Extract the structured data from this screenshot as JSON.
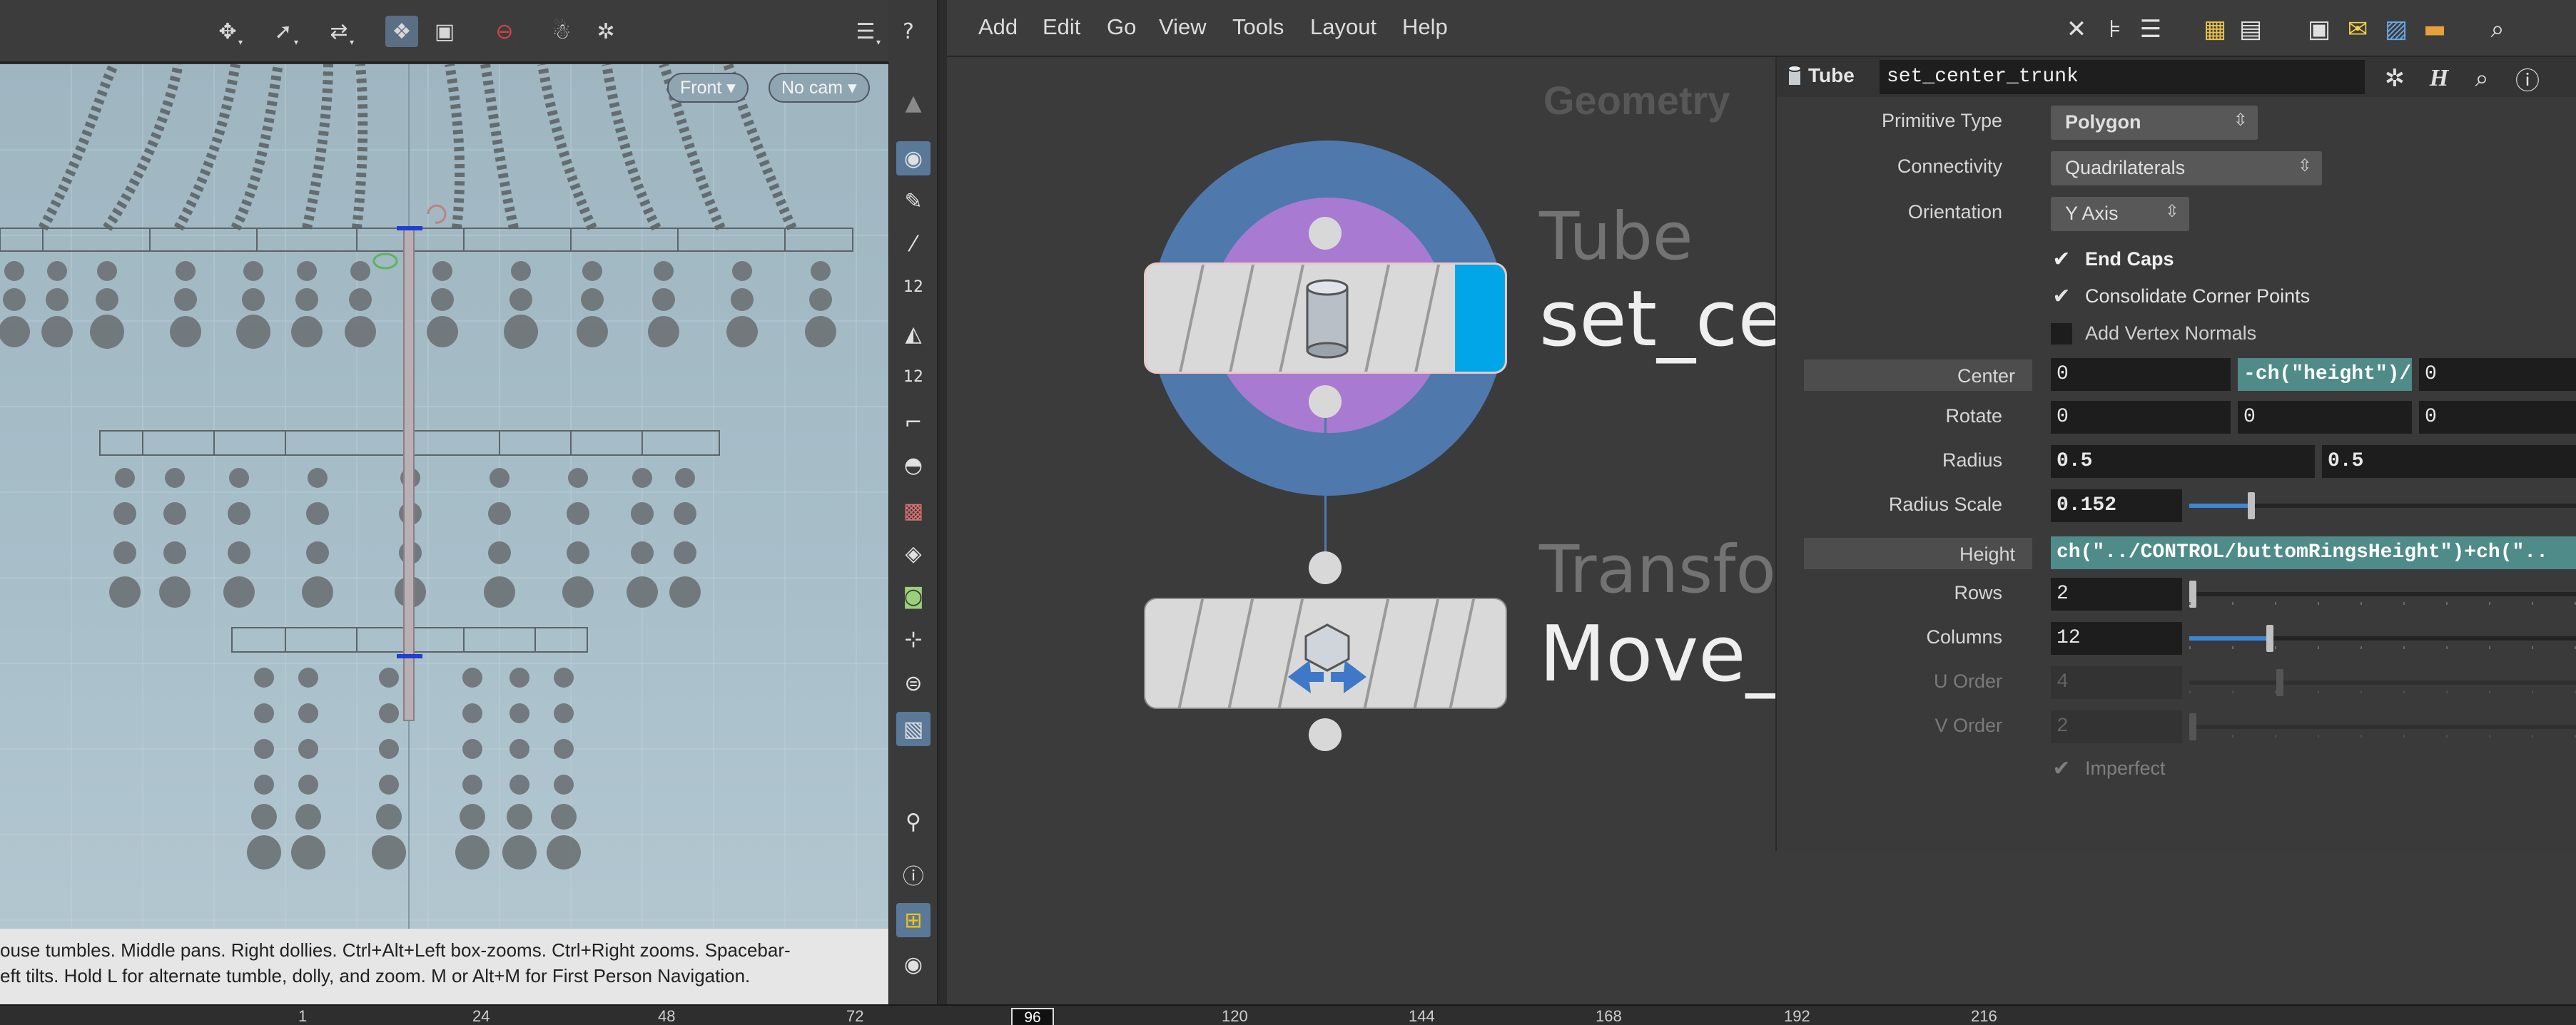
{
  "viewport": {
    "view_menu": "Front",
    "camera_menu": "No cam",
    "hint_line1": "ouse tumbles. Middle pans. Right dollies. Ctrl+Alt+Left box-zooms. Ctrl+Right zooms. Spacebar-",
    "hint_line2": "eft tilts. Hold L for alternate tumble, dolly, and zoom.      M or Alt+M for First Person Navigation.",
    "toolbar_icons": [
      "tumble-icon",
      "select-icon",
      "transform-icon",
      "ghost-icon",
      "display-icon",
      "stop-icon",
      "camera-icon",
      "snapshot-icon",
      "display-options-icon",
      "help-icon"
    ],
    "side_tool_labels": [
      "12",
      "12"
    ]
  },
  "network": {
    "menus": [
      "Add",
      "Edit",
      "Go",
      "View",
      "Tools",
      "Layout",
      "Help"
    ],
    "context_label": "Geometry",
    "nodes": [
      {
        "type": "Tube",
        "name": "set_cer"
      },
      {
        "type": "Transfor",
        "name": "Move_"
      }
    ]
  },
  "parameters": {
    "op_type": "Tube",
    "op_name": "set_center_trunk",
    "primitive_type": {
      "label": "Primitive Type",
      "value": "Polygon"
    },
    "connectivity": {
      "label": "Connectivity",
      "value": "Quadrilaterals"
    },
    "orientation": {
      "label": "Orientation",
      "value": "Y Axis"
    },
    "end_caps": {
      "label": "End Caps",
      "checked": true
    },
    "consolidate": {
      "label": "Consolidate Corner Points",
      "checked": true
    },
    "vertex_normals": {
      "label": "Add Vertex Normals",
      "checked": false
    },
    "center": {
      "label": "Center",
      "values": [
        "0",
        "-ch(\"height\")/",
        "0"
      ]
    },
    "rotate": {
      "label": "Rotate",
      "values": [
        "0",
        "0",
        "0"
      ]
    },
    "radius": {
      "label": "Radius",
      "values": [
        "0.5",
        "0.5"
      ]
    },
    "radius_scale": {
      "label": "Radius Scale",
      "value": "0.152",
      "level": 0.152
    },
    "height": {
      "label": "Height",
      "value": "ch(\"../CONTROL/buttomRingsHeight\")+ch(\".."
    },
    "rows": {
      "label": "Rows",
      "value": "2"
    },
    "columns": {
      "label": "Columns",
      "value": "12"
    },
    "u_order": {
      "label": "U Order",
      "value": "4"
    },
    "v_order": {
      "label": "V Order",
      "value": "2"
    },
    "imperfect": {
      "label": "Imperfect",
      "checked": true
    }
  },
  "timeline": {
    "ticks": [
      "1",
      "24",
      "48",
      "72",
      "120",
      "144",
      "168",
      "192",
      "216"
    ],
    "current_frame": "96"
  },
  "colors": {
    "accent_blue": "#3e86d4",
    "node_ring_outer": "#4f78ad",
    "node_ring_inner": "#a97ad1",
    "node_flag": "#00a6e8",
    "expression_bg": "#4f8b88"
  }
}
